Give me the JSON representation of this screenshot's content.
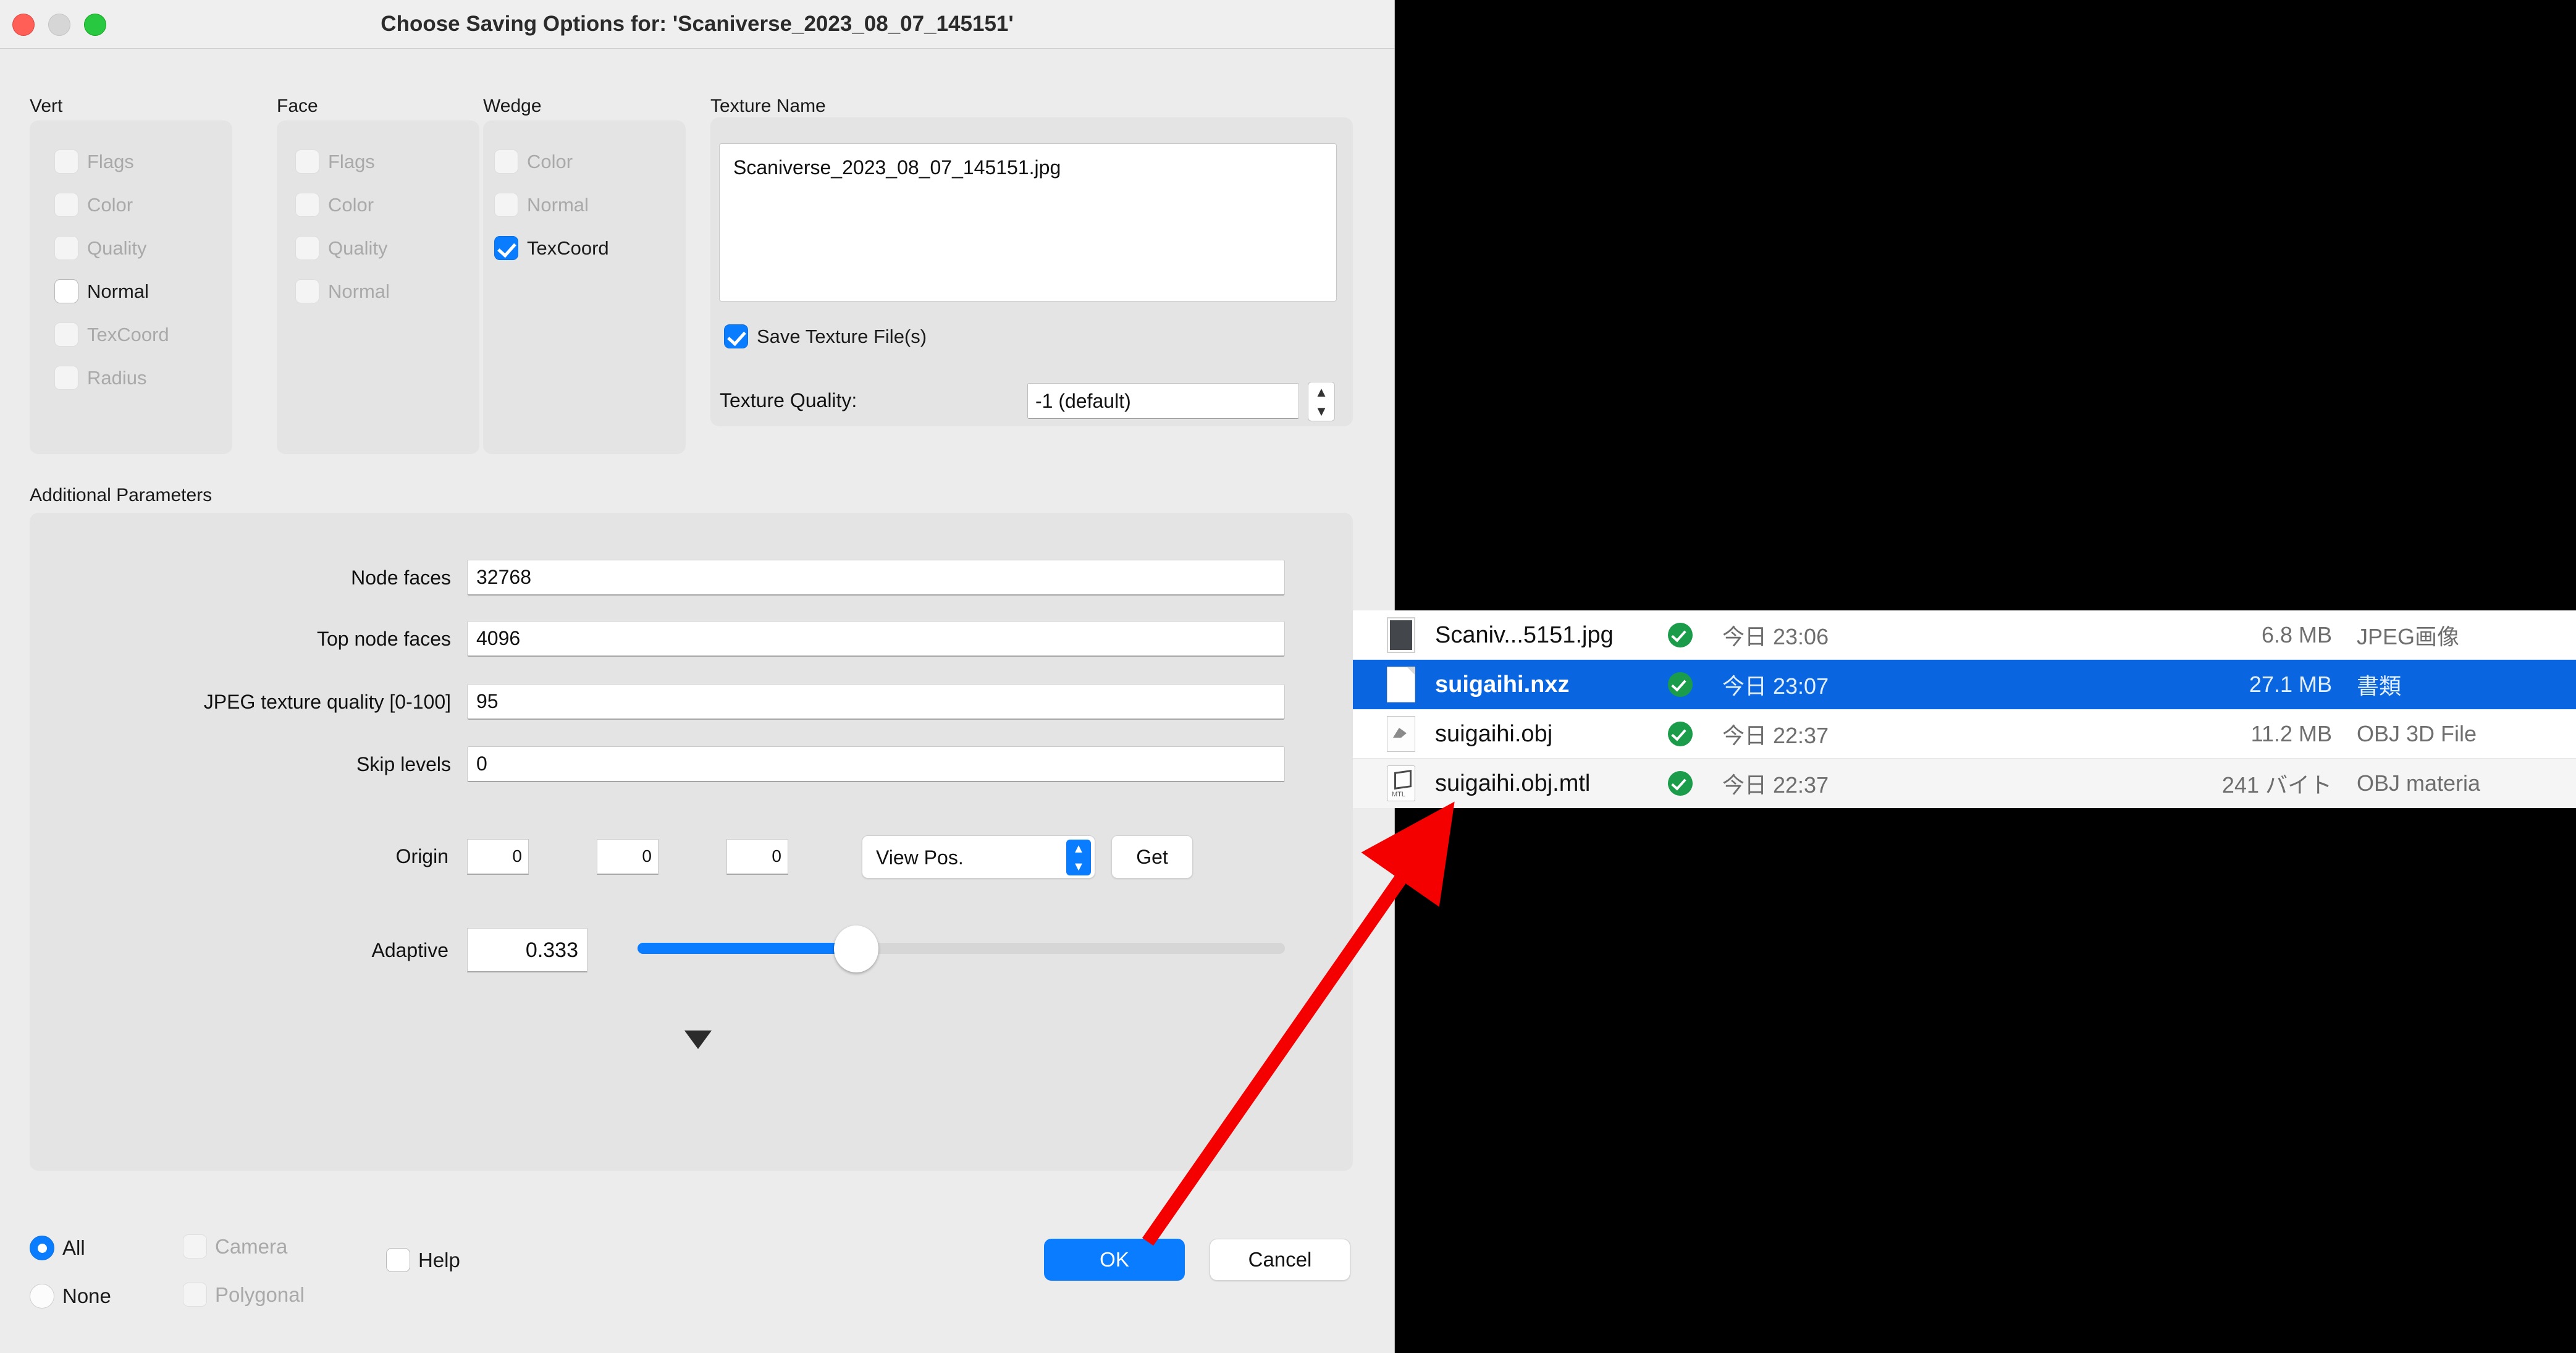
{
  "window": {
    "title": "Choose Saving Options for: 'Scaniverse_2023_08_07_145151'",
    "traffic": {
      "close": "close-button",
      "minimize": "minimize-button",
      "zoom": "zoom-button"
    }
  },
  "groups": [
    {
      "label": "Vert",
      "items": [
        {
          "label": "Flags",
          "checked": false,
          "enabled": false
        },
        {
          "label": "Color",
          "checked": false,
          "enabled": false
        },
        {
          "label": "Quality",
          "checked": false,
          "enabled": false
        },
        {
          "label": "Normal",
          "checked": false,
          "enabled": true
        },
        {
          "label": "TexCoord",
          "checked": false,
          "enabled": false
        },
        {
          "label": "Radius",
          "checked": false,
          "enabled": false
        }
      ]
    },
    {
      "label": "Face",
      "items": [
        {
          "label": "Flags",
          "checked": false,
          "enabled": false
        },
        {
          "label": "Color",
          "checked": false,
          "enabled": false
        },
        {
          "label": "Quality",
          "checked": false,
          "enabled": false
        },
        {
          "label": "Normal",
          "checked": false,
          "enabled": false
        }
      ]
    },
    {
      "label": "Wedge",
      "items": [
        {
          "label": "Color",
          "checked": false,
          "enabled": false
        },
        {
          "label": "Normal",
          "checked": false,
          "enabled": false
        },
        {
          "label": "TexCoord",
          "checked": true,
          "enabled": true
        }
      ]
    }
  ],
  "texture": {
    "group_label": "Texture Name",
    "name": "Scaniverse_2023_08_07_145151.jpg",
    "save_checkbox_label": "Save Texture File(s)",
    "save_checked": true,
    "quality_label": "Texture Quality:",
    "quality_value": "-1 (default)",
    "stepper_up": "▲",
    "stepper_down": "▼"
  },
  "additional": {
    "group_label": "Additional Parameters",
    "params": [
      {
        "label": "Node faces",
        "value": "32768"
      },
      {
        "label": "Top node faces",
        "value": "4096"
      },
      {
        "label": "JPEG texture quality [0-100]",
        "value": "95"
      },
      {
        "label": "Skip levels",
        "value": "0"
      }
    ],
    "origin": {
      "label": "Origin",
      "x": "0",
      "y": "0",
      "z": "0",
      "mode": "View Pos.",
      "get_button": "Get"
    },
    "adaptive": {
      "label": "Adaptive",
      "value": "0.333",
      "slider_fill_percent": 34
    },
    "disclosure": "▼"
  },
  "footer": {
    "all_label": "All",
    "all_selected": true,
    "none_label": "None",
    "none_selected": false,
    "camera_label": "Camera",
    "camera_checked": false,
    "polygonal_label": "Polygonal",
    "polygonal_checked": false,
    "help_label": "Help",
    "help_checked": false,
    "ok_label": "OK",
    "cancel_label": "Cancel"
  },
  "filelist": {
    "rows": [
      {
        "name": "Scaniv...5151.jpg",
        "date": "今日 23:06",
        "size": "6.8 MB",
        "kind": "JPEG画像",
        "icon": "jpeg-thumbnail-icon",
        "selected": false
      },
      {
        "name": "suigaihi.nxz",
        "date": "今日 23:07",
        "size": "27.1 MB",
        "kind": "書類",
        "icon": "generic-document-icon",
        "selected": true
      },
      {
        "name": "suigaihi.obj",
        "date": "今日 22:37",
        "size": "11.2 MB",
        "kind": "OBJ 3D File",
        "icon": "obj-3d-file-icon",
        "selected": false
      },
      {
        "name": "suigaihi.obj.mtl",
        "date": "今日 22:37",
        "size": "241 バイト",
        "kind": "OBJ materia",
        "icon": "obj-material-icon",
        "selected": false
      }
    ]
  },
  "colors": {
    "accent_blue": "#0a7cff",
    "selection_blue": "#0a66e0",
    "badge_green": "#1a9c4a",
    "annotation_red": "#f40000"
  }
}
